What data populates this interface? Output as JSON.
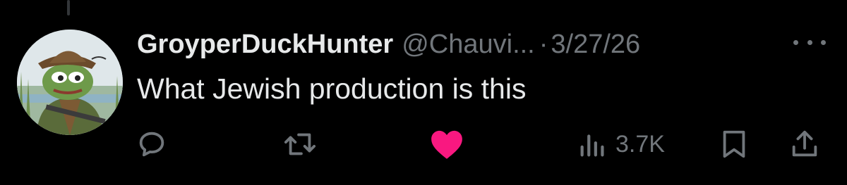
{
  "tweet": {
    "display_name": "GroyperDuckHunter",
    "handle": "@Chauvi...",
    "separator": "·",
    "date": "3/27/26",
    "text": "What Jewish production is this",
    "avatar_icon": "frog-hunter-avatar",
    "actions": {
      "reply_icon": "reply-icon",
      "retweet_icon": "retweet-icon",
      "like_icon": "heart-icon",
      "like_active": true,
      "views_icon": "views-icon",
      "views_count": "3.7K",
      "bookmark_icon": "bookmark-icon",
      "share_icon": "share-icon"
    },
    "more_icon": "more-icon"
  },
  "colors": {
    "background": "#000000",
    "primary_text": "#e7e9ea",
    "secondary_text": "#71767b",
    "like_active": "#f91880"
  }
}
